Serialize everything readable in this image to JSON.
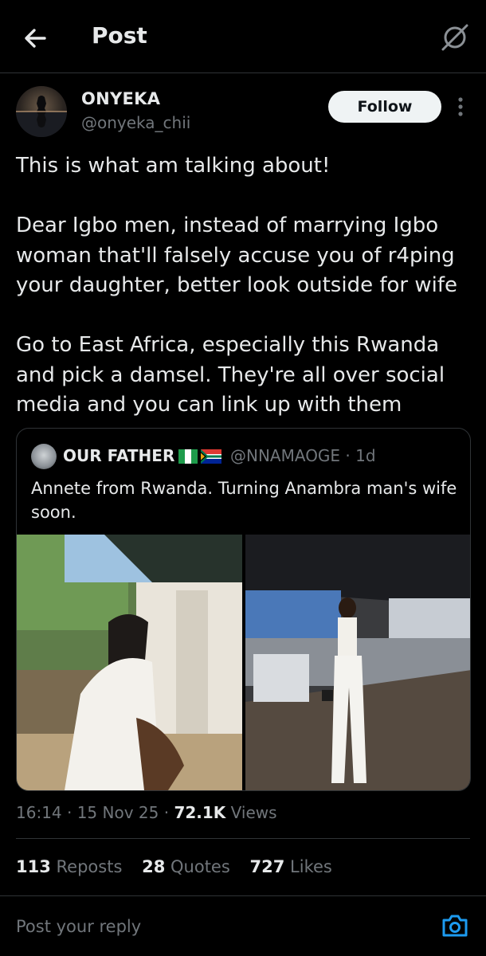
{
  "header": {
    "title": "Post",
    "back_icon": "arrow-left-icon",
    "grok_icon": "grok-icon"
  },
  "post": {
    "author": {
      "display_name": "ONYEKA",
      "handle": "@onyeka_chii"
    },
    "follow_label": "Follow",
    "more_icon": "more-vertical-icon",
    "text": "This is what am talking about!\n\nDear Igbo men, instead of marrying Igbo woman that'll falsely accuse you of r4ping your daughter, better look outside for wife\n\nGo to East Africa, especially this Rwanda and pick a damsel. They're all over social media and you can link up with them",
    "quoted": {
      "display_name": "OUR FATHER",
      "flags": [
        "nigeria-flag-icon",
        "south-africa-flag-icon"
      ],
      "handle_time": "@NNAMAOGE · 1d",
      "text": "Annete from Rwanda. Turning Anambra man's wife soon."
    },
    "meta": {
      "time_date": "16:14 · 15 Nov 25 · ",
      "views_count": "72.1K",
      "views_label": " Views"
    },
    "stats": [
      {
        "count": "113",
        "label": "Reposts"
      },
      {
        "count": "28",
        "label": "Quotes"
      },
      {
        "count": "727",
        "label": "Likes"
      }
    ]
  },
  "reply": {
    "placeholder": "Post your reply",
    "camera_icon": "camera-icon"
  },
  "colors": {
    "background": "#000000",
    "text_primary": "#e7e9ea",
    "text_secondary": "#71767b",
    "border": "#2f3336",
    "accent": "#1d9bf0"
  }
}
